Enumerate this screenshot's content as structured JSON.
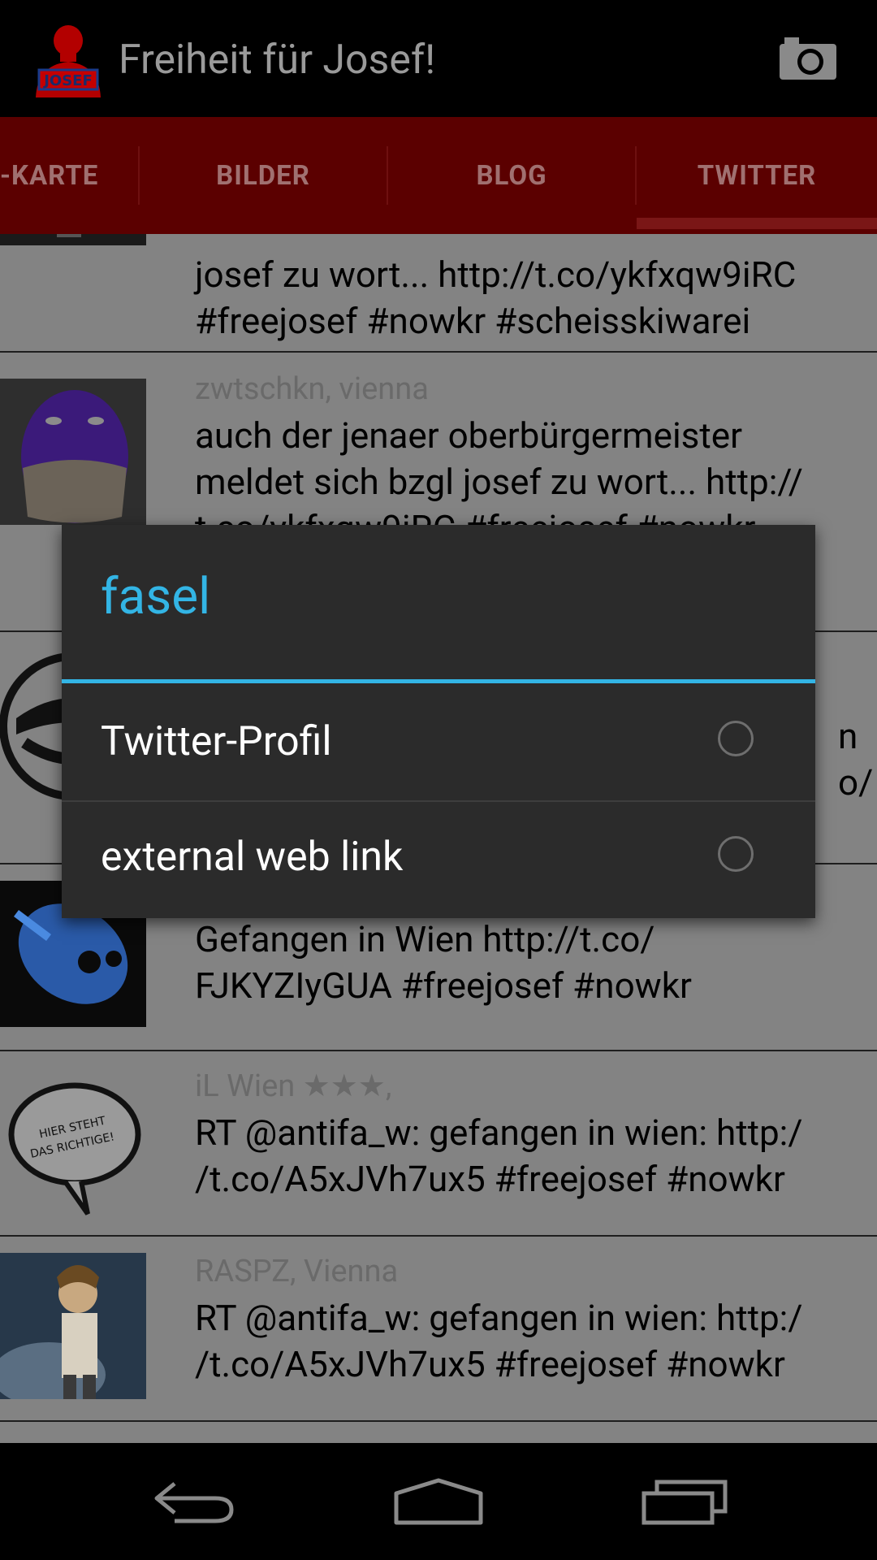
{
  "app": {
    "title": "Freiheit für Josef!",
    "icon_label": "JOSEF"
  },
  "tabs": [
    {
      "label": "-KARTE"
    },
    {
      "label": "BILDER"
    },
    {
      "label": "BLOG"
    },
    {
      "label": "TWITTER",
      "selected": true
    }
  ],
  "tweets": [
    {
      "user": "",
      "text": "josef zu wort... http://t.co/ykfxqw9iRC\n#freejosef #nowkr #scheisskiwarei",
      "avatar": "partial-avatar"
    },
    {
      "user": "zwtschkn, vienna",
      "text": "auch der jenaer oberbürgermeister\nmeldet sich bzgl josef zu wort... http://\nt.co/ykfxqw9iRC #freejosef #nowkr",
      "avatar": "balaclava-avatar"
    },
    {
      "user": "",
      "text": "n\no/",
      "avatar": "antifa-avatar"
    },
    {
      "user": "",
      "text": "Gefangen in Wien http://t.co/\nFJKYZIyGUA #freejosef #nowkr",
      "avatar": "blue-logo-avatar"
    },
    {
      "user": "iL Wien ★★★,",
      "text": "RT @antifa_w: gefangen in wien: http:/\n/t.co/A5xJVh7ux5 #freejosef #nowkr",
      "avatar": "speech-bubble-avatar"
    },
    {
      "user": "RASPZ, Vienna",
      "text": "RT @antifa_w: gefangen in wien: http:/\n/t.co/A5xJVh7ux5 #freejosef #nowkr",
      "avatar": "illustration-avatar"
    }
  ],
  "dialog": {
    "title": "fasel",
    "options": [
      {
        "label": "Twitter-Profil",
        "checked": false
      },
      {
        "label": "external web link",
        "checked": false
      }
    ]
  },
  "navbar": {
    "back": "back-icon",
    "home": "home-icon",
    "recents": "recents-icon"
  },
  "colors": {
    "accent": "#33b5e5",
    "tab_bar": "#5b0000",
    "dialog_bg": "#2b2b2b"
  }
}
